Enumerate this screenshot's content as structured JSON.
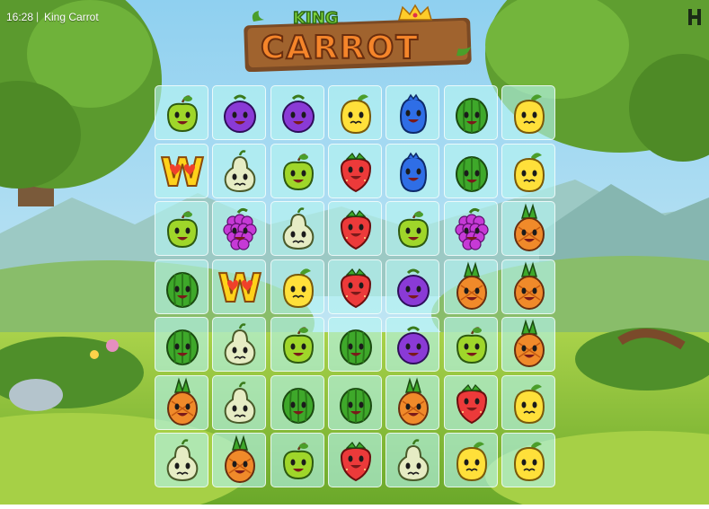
{
  "status_bar": {
    "time": "16:28",
    "game_title": "King Carrot"
  },
  "logo": {
    "small_text": "KING",
    "big_text": "CARROT"
  },
  "menu_icon": "hamburger-h-icon",
  "board": {
    "columns": 7,
    "rows": 7,
    "symbols": [
      [
        "green-apple",
        "purple-plum",
        "purple-plum",
        "lemon",
        "blueberry",
        "watermelon",
        "lemon"
      ],
      [
        "wild",
        "pear",
        "green-apple",
        "strawberry",
        "blueberry",
        "watermelon",
        "lemon"
      ],
      [
        "green-apple",
        "grapes",
        "pear",
        "strawberry",
        "green-apple",
        "grapes",
        "pineapple"
      ],
      [
        "watermelon",
        "wild",
        "lemon",
        "strawberry",
        "purple-plum",
        "pineapple",
        "pineapple"
      ],
      [
        "watermelon",
        "pear",
        "green-apple",
        "watermelon",
        "purple-plum",
        "green-apple",
        "pineapple"
      ],
      [
        "pineapple",
        "pear",
        "watermelon",
        "watermelon",
        "pineapple",
        "strawberry",
        "lemon"
      ],
      [
        "pear",
        "pineapple",
        "green-apple",
        "strawberry",
        "pear",
        "lemon",
        "lemon"
      ]
    ]
  },
  "wild_label": "W",
  "colors": {
    "sky": "#9fd7f2",
    "grass": "#8cc43a",
    "cell_bg": "#bdf5f0",
    "logo_orange": "#f5852a",
    "logo_green": "#4a9e2a"
  }
}
